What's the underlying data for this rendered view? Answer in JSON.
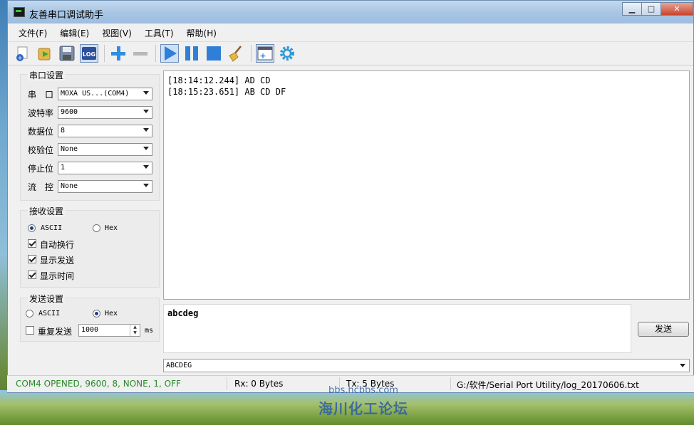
{
  "window": {
    "title": "友善串口调试助手"
  },
  "menu": [
    "文件(F)",
    "编辑(E)",
    "视图(V)",
    "工具(T)",
    "帮助(H)"
  ],
  "toolbar": {
    "buttons": [
      "new-icon",
      "open-icon",
      "save-icon",
      "log-icon",
      "add-icon",
      "remove-icon",
      "play-icon",
      "pause-icon",
      "stop-icon",
      "broom-icon",
      "new-window-icon",
      "gear-icon"
    ],
    "log_label": "LOG"
  },
  "serial_settings": {
    "title": "串口设置",
    "port": {
      "label": "串　口",
      "value": "MOXA US...(COM4)"
    },
    "baud": {
      "label": "波特率",
      "value": "9600"
    },
    "databits": {
      "label": "数据位",
      "value": "8"
    },
    "parity": {
      "label": "校验位",
      "value": "None"
    },
    "stopbits": {
      "label": "停止位",
      "value": "1"
    },
    "flow": {
      "label": "流　控",
      "value": "None"
    }
  },
  "receive_settings": {
    "title": "接收设置",
    "ascii": "ASCII",
    "hex": "Hex",
    "auto_wrap": "自动换行",
    "show_sent": "显示发送",
    "show_time": "显示时间"
  },
  "send_settings": {
    "title": "发送设置",
    "ascii": "ASCII",
    "hex": "Hex",
    "repeat": "重复发送",
    "interval": "1000",
    "unit": "ms"
  },
  "receive_lines": [
    "[18:14:12.244] AD CD",
    "[18:15:23.651] AB CD DF"
  ],
  "send_text": "abcdeg",
  "send_button": "发送",
  "history_value": "ABCDEG",
  "status": {
    "connection": "COM4 OPENED, 9600, 8, NONE, 1, OFF",
    "rx": "Rx: 0 Bytes",
    "tx": "Tx: 5 Bytes",
    "log_path": "G:/软件/Serial Port Utility/log_20170606.txt"
  },
  "watermark": {
    "line1": "bbs.hcbbs.com",
    "line2": "海川化工论坛"
  },
  "colors": {
    "status_green": "#2a8a2a",
    "accent_blue": "#2f7fd6"
  }
}
